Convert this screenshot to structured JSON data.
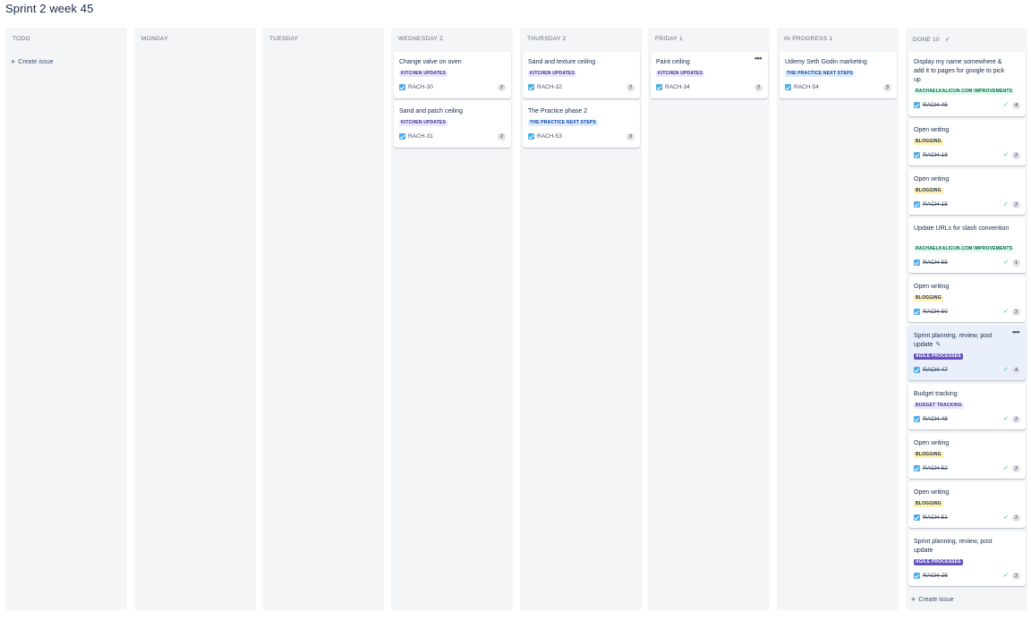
{
  "board": {
    "title": "Sprint 2 week 45"
  },
  "columns": [
    {
      "name": "TODO",
      "cards": [],
      "create_label": "Create issue"
    },
    {
      "name": "MONDAY",
      "cards": []
    },
    {
      "name": "TUESDAY",
      "cards": []
    },
    {
      "name": "WEDNESDAY 2",
      "cards": [
        {
          "title": "Change valve on oven",
          "epic": "KITCHEN UPDATES",
          "key": "RACH-30",
          "points": "2"
        },
        {
          "title": "Sand and patch ceiling",
          "epic": "KITCHEN UPDATES",
          "key": "RACH-31",
          "points": "2"
        }
      ]
    },
    {
      "name": "THURSDAY 2",
      "cards": [
        {
          "title": "Sand and texture ceiling",
          "epic": "KITCHEN UPDATES",
          "key": "RACH-32",
          "points": "2"
        },
        {
          "title": "The Practice phase 2",
          "epic": "THE PRACTICE NEXT STEPS",
          "key": "RACH-53",
          "points": "3"
        }
      ]
    },
    {
      "name": "FRIDAY 1",
      "cards": [
        {
          "title": "Paint ceiling",
          "epic": "KITCHEN UPDATES",
          "key": "RACH-34",
          "points": "2"
        }
      ]
    },
    {
      "name": "IN PROGRESS 1",
      "cards": [
        {
          "title": "Udemy Seth Godin marketing",
          "epic": "THE PRACTICE NEXT STEPS",
          "key": "RACH-54",
          "points": "3"
        }
      ]
    },
    {
      "name": "DONE 10",
      "create_label": "Create issue",
      "cards": [
        {
          "title": "Display my name somewhere & add it to pages for google to pick up",
          "epic": "RACHAELKALICUN.COM IMPROVEMENTS",
          "key": "RACH-46",
          "points": "4"
        },
        {
          "title": "Open writing",
          "epic": "BLOGGING",
          "key": "RACH-18",
          "points": "2"
        },
        {
          "title": "Open writing",
          "epic": "BLOGGING",
          "key": "RACH-15",
          "points": "2"
        },
        {
          "title": "Update URLs for slash convention",
          "epic": "RACHAELKALICUN.COM IMPROVEMENTS",
          "key": "RACH-55",
          "points": "1"
        },
        {
          "title": "Open writing",
          "epic": "BLOGGING",
          "key": "RACH-50",
          "points": "2"
        },
        {
          "title": "Sprint planning, review, post update",
          "epic": "AGILE PROCESSES",
          "key": "RACH-47",
          "points": "4"
        },
        {
          "title": "Budget tracking",
          "epic": "BUDGET TRACKING",
          "key": "RACH-48",
          "points": "2"
        },
        {
          "title": "Open writing",
          "epic": "BLOGGING",
          "key": "RACH-52",
          "points": "2"
        },
        {
          "title": "Open writing",
          "epic": "BLOGGING",
          "key": "RACH-51",
          "points": "2"
        },
        {
          "title": "Sprint planning, review, post update",
          "epic": "AGILE PROCESSES",
          "key": "RACH-28",
          "points": "2"
        }
      ]
    }
  ],
  "icons": {
    "task": "task-checkbox-icon",
    "more": "more-horizontal-icon",
    "done": "checkmark-icon",
    "add": "plus-icon",
    "edit": "pencil-icon"
  },
  "colors": {
    "column_bg": "#f4f5f7",
    "task_icon": "#4bade8",
    "epic_kitchen": "#eae6ff",
    "epic_practice": "#deebff",
    "epic_rach": "#e3fcef",
    "epic_blogging": "#fff0b3",
    "epic_agile": "#6554c0",
    "done_tick": "#36b37e",
    "highlight_card": "#e9f0fb"
  }
}
